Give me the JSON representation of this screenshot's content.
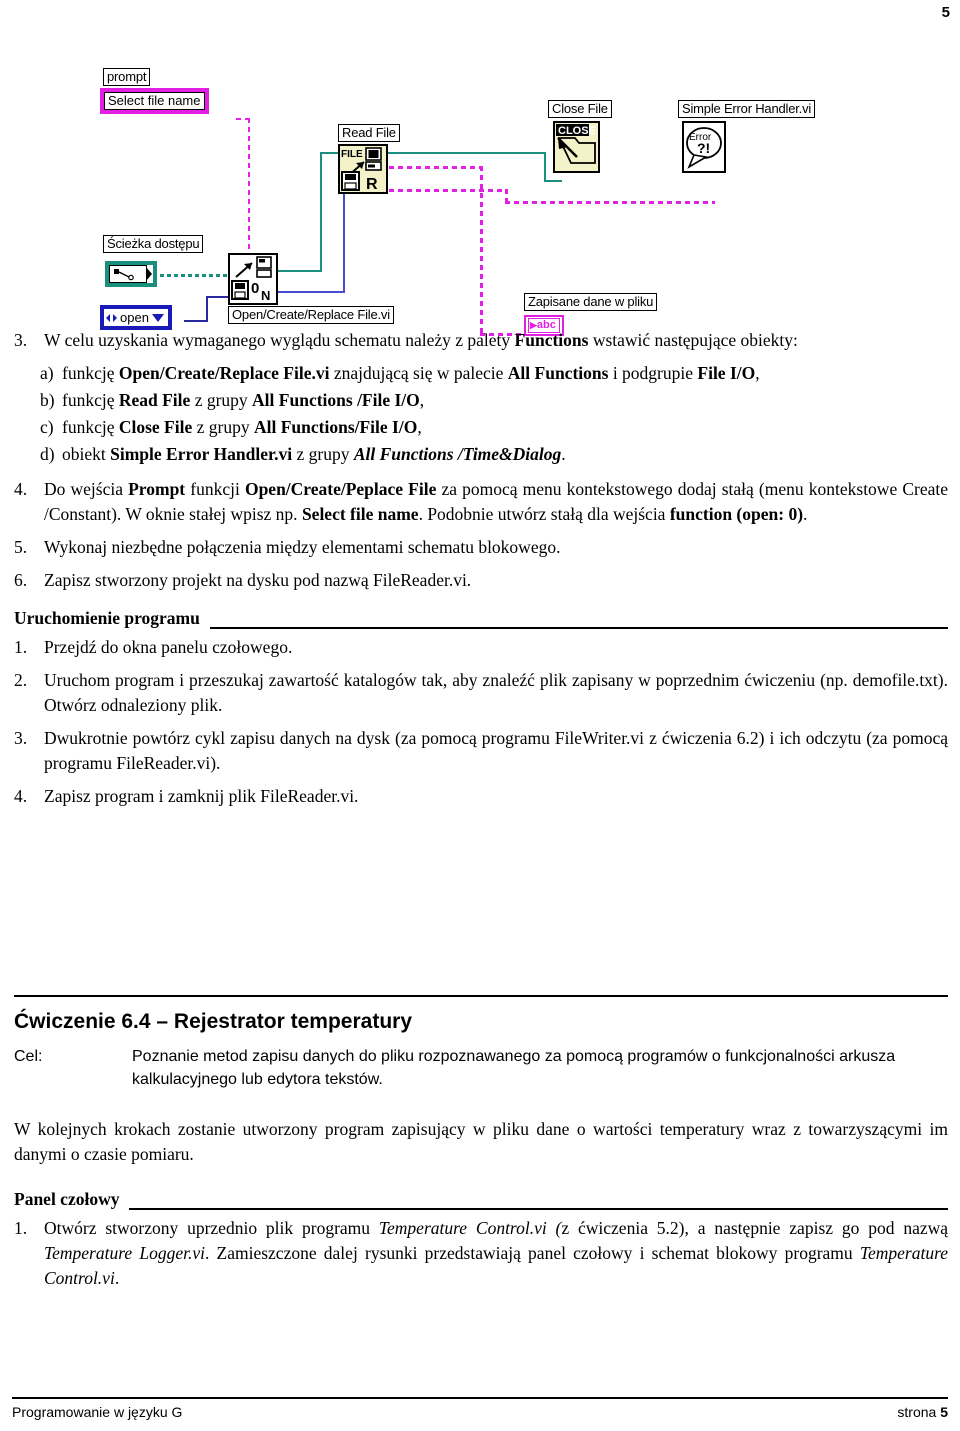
{
  "page": {
    "number_top": "5",
    "footer_left": "Programowanie w języku G",
    "footer_right_label": "strona",
    "footer_right_number": "5"
  },
  "figure": {
    "name": "labview-block-diagram-filereader",
    "labels": {
      "prompt": "prompt",
      "select_file_name": "Select file name",
      "sciezka_dostepu": "Ścieżka dostępu",
      "open_constant": "open",
      "open_create_replace": "Open/Create/Replace File.vi",
      "read_file": "Read File",
      "read_file_icon_file": "FILE",
      "read_file_icon_r": "R",
      "close_file": "Close File",
      "close_file_icon": "CLOSE",
      "simple_error_handler": "Simple Error Handler.vi",
      "error_icon_top": "Error",
      "error_icon_bottom": "?!",
      "zapisane_dane": "Zapisane dane w pliku",
      "abc_indicator": "abc",
      "ocr_icon_zero": "0",
      "ocr_icon_n": "N"
    },
    "colors": {
      "pink_wire": "#e31fe3",
      "teal_wire": "#1b8f7e",
      "blue_wire": "#4a4ad0",
      "dark_blue_border": "#1a1ab8",
      "vi_icon_fill": "#f4f2c8"
    }
  },
  "item3": {
    "num": "3.",
    "lead_a": "W celu uzyskania wymaganego wyglądu schematu należy z palety ",
    "lead_b": "Functions",
    "lead_c": " wstawić następujące obiekty:",
    "subs": [
      {
        "num": "a)",
        "p1": "funkcję ",
        "b1": "Open/Create/Replace File.vi",
        "p2": " znajdującą się w palecie ",
        "b2": "All Functions",
        "p3": " i podgrupie ",
        "b3": "File I/O",
        "p4": ","
      },
      {
        "num": "b)",
        "p1": "funkcję ",
        "b1": "Read File",
        "p2": " z grupy ",
        "b2": "All Functions /File I/O",
        "p3": "",
        "b3": "",
        "p4": ","
      },
      {
        "num": "c)",
        "p1": "funkcję ",
        "b1": "Close File",
        "p2": " z grupy ",
        "b2": "All Functions/File I/O",
        "p3": "",
        "b3": "",
        "p4": ","
      },
      {
        "num": "d)",
        "p1": "obiekt ",
        "b1": "Simple Error Handler.vi",
        "p2": " z grupy ",
        "i2": "All Functions /Time&Dialog",
        "p4": "."
      }
    ]
  },
  "item4": {
    "num": "4.",
    "t1": "Do wejścia ",
    "b1": "Prompt",
    "t2": " funkcji ",
    "b2": "Open/Create/Peplace File",
    "t3": " za pomocą menu kontekstowego dodaj stałą (menu kontekstowe Create /Constant). W oknie stałej wpisz np. ",
    "b3": "Select file name",
    "t4": ". Podobnie utwórz stałą dla wejścia ",
    "b4": "function (open: 0)",
    "t5": "."
  },
  "item5": {
    "num": "5.",
    "text": "Wykonaj niezbędne połączenia między elementami schematu blokowego."
  },
  "item6": {
    "num": "6.",
    "text": "Zapisz stworzony projekt na dysku pod nazwą FileReader.vi."
  },
  "uruchomienie": {
    "heading": "Uruchomienie programu",
    "items": [
      {
        "num": "1.",
        "text": "Przejdź do okna panelu czołowego."
      },
      {
        "num": "2.",
        "text": "Uruchom program i przeszukaj zawartość katalogów tak, aby znaleźć plik zapisany w poprzednim ćwiczeniu (np. demofile.txt). Otwórz odnaleziony plik."
      },
      {
        "num": "3.",
        "text": "Dwukrotnie powtórz cykl zapisu danych na dysk (za pomocą programu FileWriter.vi z ćwiczenia 6.2) i ich odczytu (za pomocą programu FileReader.vi)."
      },
      {
        "num": "4.",
        "text": "Zapisz program i zamknij plik FileReader.vi."
      }
    ]
  },
  "exercise": {
    "title": "Ćwiczenie 6.4 – Rejestrator temperatury",
    "cel_label": "Cel:",
    "cel_text": "Poznanie metod zapisu danych do pliku rozpoznawanego za pomocą programów o funkcjonalności arkusza kalkulacyjnego lub edytora tekstów.",
    "intro": "W kolejnych krokach zostanie utworzony program zapisujący w pliku dane o wartości temperatury wraz z towarzyszącymi im danymi o czasie pomiaru."
  },
  "panel": {
    "heading": "Panel czołowy",
    "item1_num": "1.",
    "item1_t1": "Otwórz stworzony uprzednio plik programu ",
    "item1_i1": "Temperature Control.vi (",
    "item1_t2": "z ćwiczenia 5.2), a następnie zapisz go pod nazwą ",
    "item1_i2": "Temperature Logger.vi",
    "item1_t3": ". Zamieszczone dalej rysunki przedstawiają panel czołowy i schemat blokowy programu ",
    "item1_i3": "Temperature Control.vi",
    "item1_t4": "."
  }
}
